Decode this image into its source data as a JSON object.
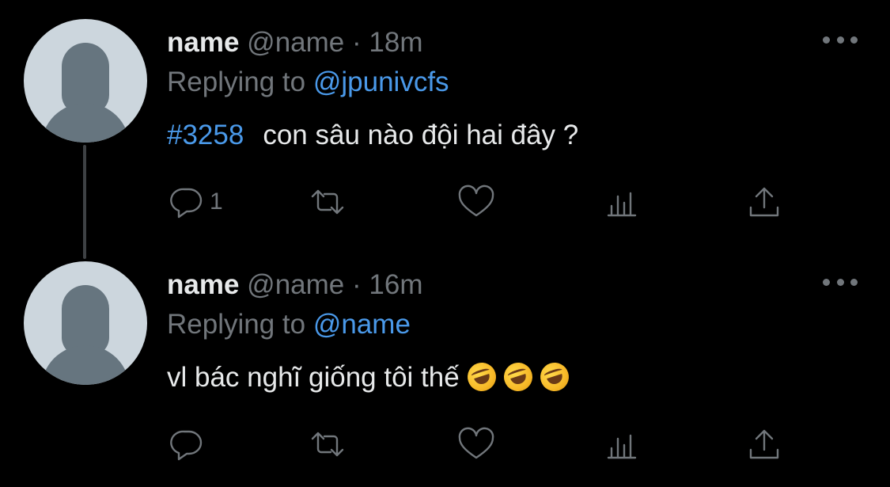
{
  "tweets": [
    {
      "display_name": "name",
      "handle": "@name",
      "separator": "·",
      "time": "18m",
      "replying_prefix": "Replying to",
      "replying_to": "@jpunivcfs",
      "hashtag": "#3258",
      "text": "con sâu nào đội hai đây ?",
      "emojis": [],
      "reply_count": "1",
      "icons": [
        "reply-icon",
        "retweet-icon",
        "like-icon",
        "analytics-icon",
        "share-icon",
        "more-icon"
      ]
    },
    {
      "display_name": "name",
      "handle": "@name",
      "separator": "·",
      "time": "16m",
      "replying_prefix": "Replying to",
      "replying_to": "@name",
      "hashtag": "",
      "text": "vl bác nghĩ giống tôi thế",
      "emojis": [
        "rolling-on-the-floor-laughing",
        "rolling-on-the-floor-laughing",
        "rolling-on-the-floor-laughing"
      ],
      "reply_count": "",
      "icons": [
        "reply-icon",
        "retweet-icon",
        "like-icon",
        "analytics-icon",
        "share-icon",
        "more-icon"
      ]
    }
  ],
  "colors": {
    "background": "#000000",
    "text": "#e7e9ea",
    "secondary": "#71767b",
    "link": "#4a99e9",
    "thread_line": "#3e4144",
    "avatar_bg": "#ccd6dd",
    "avatar_fg": "#66757f"
  }
}
